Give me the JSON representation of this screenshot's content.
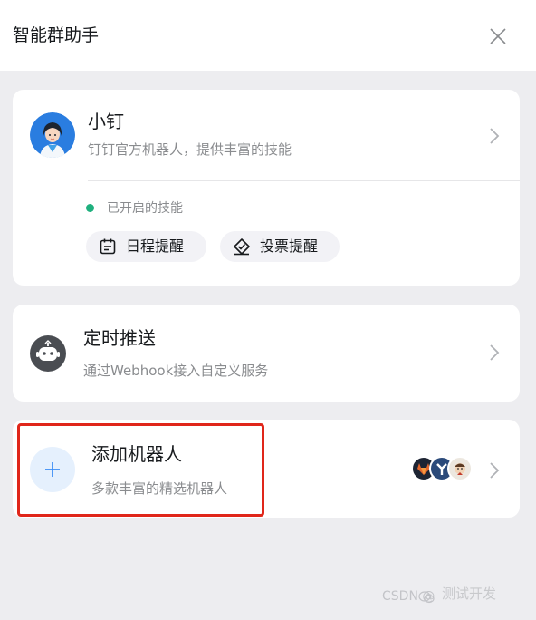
{
  "header": {
    "title": "智能群助手",
    "close_icon": "close-icon"
  },
  "xiaoding": {
    "name": "小钉",
    "description": "钉钉官方机器人，提供丰富的技能",
    "enabled_skills_label": "已开启的技能",
    "status_color": "#1fb07e",
    "skills": [
      {
        "label": "日程提醒",
        "icon": "calendar-icon"
      },
      {
        "label": "投票提醒",
        "icon": "vote-icon"
      }
    ]
  },
  "scheduled_push": {
    "title": "定时推送",
    "description": "通过Webhook接入自定义服务",
    "icon": "robot-icon"
  },
  "add_robot": {
    "title": "添加机器人",
    "description": "多款丰富的精选机器人",
    "icon": "plus-icon",
    "accent": "#3d8ef5"
  },
  "watermark": {
    "csdn": "CSDN @",
    "wechat": "测试开发"
  },
  "colors": {
    "background": "#ededf0",
    "card": "#ffffff",
    "highlight_border": "#e0261a"
  }
}
